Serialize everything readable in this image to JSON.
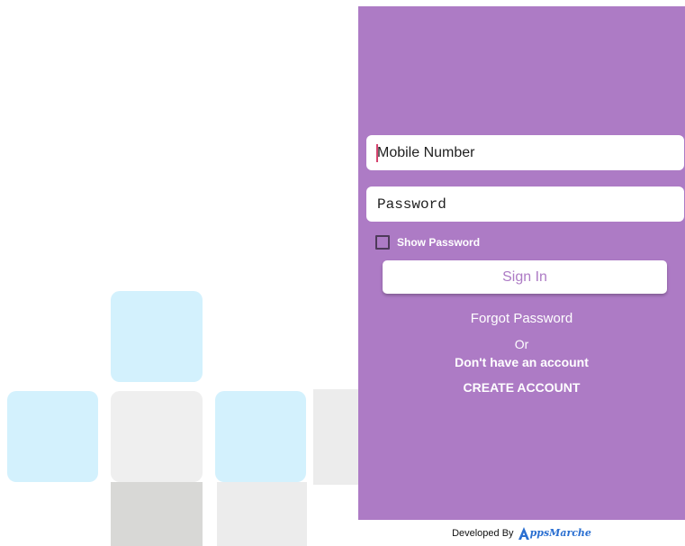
{
  "login": {
    "mobile_placeholder": "Mobile Number",
    "password_placeholder": "Password",
    "show_password_label": "Show Password",
    "sign_in_label": "Sign In",
    "forgot_password_label": "Forgot Password",
    "or_label": "Or",
    "no_account_label": "Don't have an account",
    "create_account_label": "CREATE ACCOUNT"
  },
  "footer": {
    "developed_by_label": "Developed By",
    "brand_name": "AppsMarche",
    "brand_rest": "ppsMarche",
    "brand_icon": "a-triangle-logo"
  },
  "colors": {
    "panel": "#ad7bc5",
    "tile_blue": "#d3f1fd",
    "tile_grey": "#efefef",
    "brand_blue": "#2a6fd1"
  }
}
